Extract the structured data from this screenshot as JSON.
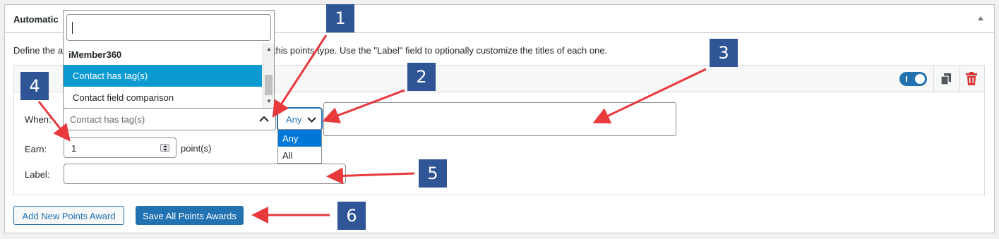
{
  "metabox": {
    "title": "Automatic",
    "description_left": "Define the a",
    "description_right": "this points type. Use the \"Label\" field to optionally customize the titles of each one."
  },
  "combo_dropdown": {
    "search_value": "",
    "group_label": "iMember360",
    "options": [
      "Contact has tag(s)",
      "Contact field comparison"
    ],
    "highlighted": "Contact has tag(s)"
  },
  "award": {
    "enabled": true,
    "icons": {
      "toggle": "toggle-switch-icon",
      "duplicate": "duplicate-icon",
      "delete": "trash-icon"
    },
    "when_label": "When:",
    "when_value": "Contact has tag(s)",
    "match_select": {
      "value": "Any",
      "options": [
        "Any",
        "All"
      ],
      "selected": "Any"
    },
    "tags_value": "",
    "earn_label": "Earn:",
    "earn_value": "1",
    "earn_suffix": "point(s)",
    "label_label": "Label:",
    "label_value": ""
  },
  "buttons": {
    "add": "Add New Points Award",
    "save": "Save All Points Awards"
  },
  "callouts": [
    "1",
    "2",
    "3",
    "4",
    "5",
    "6"
  ],
  "colors": {
    "primary": "#2271b1",
    "highlight": "#0b9bd1",
    "callout": "#2f5597",
    "arrow": "#e8393d",
    "delete": "#d63638"
  }
}
